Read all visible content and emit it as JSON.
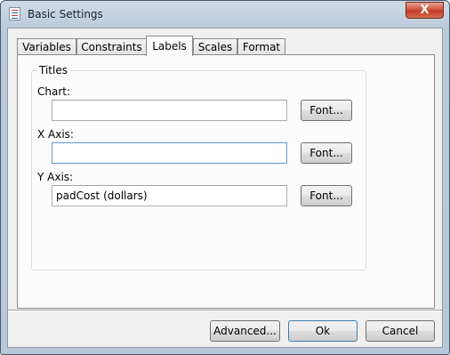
{
  "window": {
    "title": "Basic Settings",
    "close_label": "X"
  },
  "tabs": [
    {
      "label": "Variables",
      "active": false
    },
    {
      "label": "Constraints",
      "active": false
    },
    {
      "label": "Labels",
      "active": true
    },
    {
      "label": "Scales",
      "active": false
    },
    {
      "label": "Format",
      "active": false
    }
  ],
  "titles": {
    "group_label": "Titles",
    "chart": {
      "label": "Chart:",
      "value": "",
      "font_button": "Font..."
    },
    "x_axis": {
      "label": "X Axis:",
      "value": "",
      "font_button": "Font..."
    },
    "y_axis": {
      "label": "Y Axis:",
      "value": "padCost (dollars)",
      "font_button": "Font..."
    }
  },
  "buttons": {
    "advanced": "Advanced...",
    "ok": "Ok",
    "cancel": "Cancel"
  },
  "colors": {
    "title_bar": "#bccbdb",
    "close_button": "#c23c25",
    "focus_border": "#5b9bd5"
  },
  "icons": {
    "app": "app-form-icon",
    "close": "close-icon"
  }
}
